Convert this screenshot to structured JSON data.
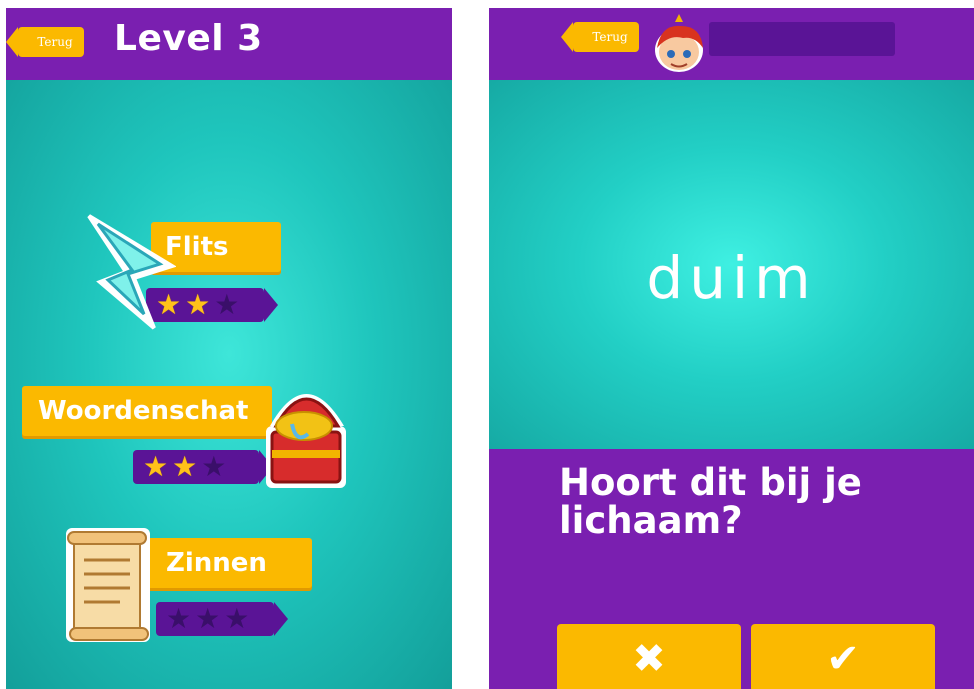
{
  "left_screen": {
    "back_label": "Terug",
    "title": "Level 3",
    "menu": [
      {
        "label": "Flits",
        "stars_earned": 2,
        "stars_total": 3,
        "icon": "lightning-icon"
      },
      {
        "label": "Woordenschat",
        "stars_earned": 2,
        "stars_total": 3,
        "icon": "treasure-chest-icon"
      },
      {
        "label": "Zinnen",
        "stars_earned": 0,
        "stars_total": 3,
        "icon": "scroll-icon"
      }
    ]
  },
  "right_screen": {
    "back_label": "Terug",
    "avatar_icon": "red-haired-character-icon",
    "word": "duim",
    "question": "Hoort dit bij je lichaam?",
    "answers": [
      {
        "label": "✖",
        "icon": "cross-icon"
      },
      {
        "label": "✔",
        "icon": "check-icon"
      }
    ]
  },
  "colors": {
    "purple": "#7a1fb0",
    "dark_purple": "#5a1496",
    "teal": "#22cfc5",
    "yellow": "#fbb900"
  }
}
